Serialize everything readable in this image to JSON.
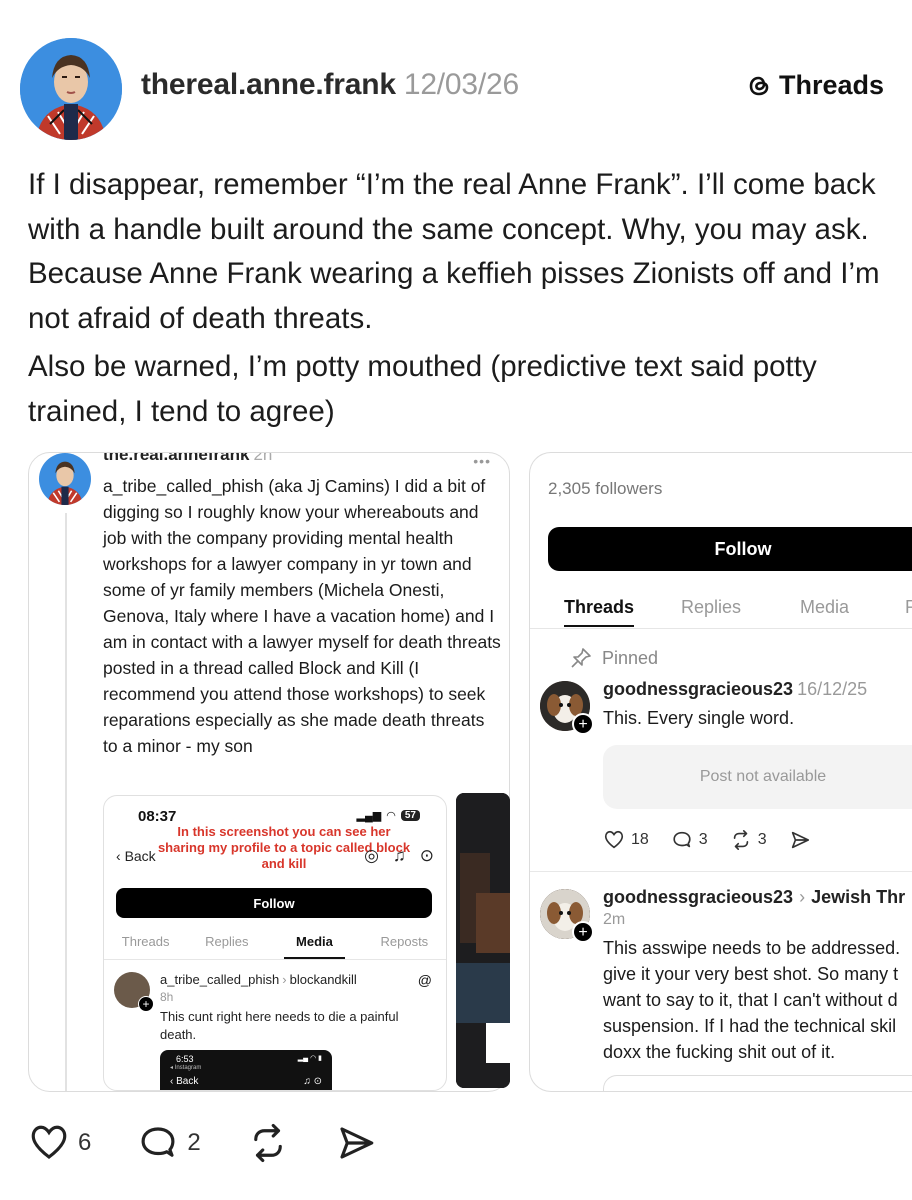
{
  "post": {
    "username": "thereal.anne.frank",
    "date": "12/03/26",
    "brand": "Threads",
    "paragraphs": [
      "If I disappear, remember “I’m the real Anne Frank”. I’ll come back with a handle built around the same concept. Why, you may ask. Because Anne Frank wearing a keffieh pisses Zionists off and I’m not afraid of death threats.",
      "Also be warned, I’m potty mouthed (predictive text said potty trained, I tend to agree)"
    ],
    "actions": {
      "likes": "6",
      "replies": "2"
    }
  },
  "left_card": {
    "handle": "the.real.annefrank",
    "time": "2h",
    "dots": "•••",
    "text": "a_tribe_called_phish (aka Jj Camins) I did a bit of digging so I roughly know your whereabouts and job with the company providing mental health workshops for a lawyer company in yr town and some of yr family members (Michela Onesti, Genova, Italy where I have a vacation home) and I am in contact with a lawyer myself for death threats posted in a thread called Block and Kill (I recommend you attend those workshops) to seek reparations especially as she made death threats to a minor - my son",
    "inner": {
      "time": "08:37",
      "battery": "57",
      "note": "In this screenshot you can see her sharing my profile to a topic called block and kill",
      "back": "Back",
      "follow": "Follow",
      "tabs": [
        "Threads",
        "Replies",
        "Media",
        "Reposts"
      ],
      "active_tab": "Media",
      "user": "a_tribe_called_phish",
      "topic": "blockandkill",
      "ago": "8h",
      "post": "This cunt right here needs to die a painful death.",
      "mini": {
        "time": "6:53",
        "app": "◂ Instagram",
        "back": "Back"
      }
    }
  },
  "right_card": {
    "followers": "2,305 followers",
    "follow": "Follow",
    "tabs": [
      "Threads",
      "Replies",
      "Media",
      "R"
    ],
    "pinned": "Pinned",
    "post1": {
      "user": "goodnessgracieous23",
      "date": "16/12/25",
      "text": "This. Every single word.",
      "not_available": "Post not available",
      "likes": "18",
      "replies": "3",
      "reposts": "3"
    },
    "post2": {
      "user": "goodnessgracieous23",
      "topic": "Jewish Thr",
      "ago": "2m",
      "lines": [
        "This asswipe needs to be addressed.",
        "give it your very best shot. So many t",
        "want to say to it, that I can't without d",
        "suspension. If I had the technical skil",
        "doxx the fucking shit out of it."
      ]
    }
  },
  "colors": {
    "accent_red": "#d8362b",
    "black": "#000000",
    "muted": "#999999"
  }
}
